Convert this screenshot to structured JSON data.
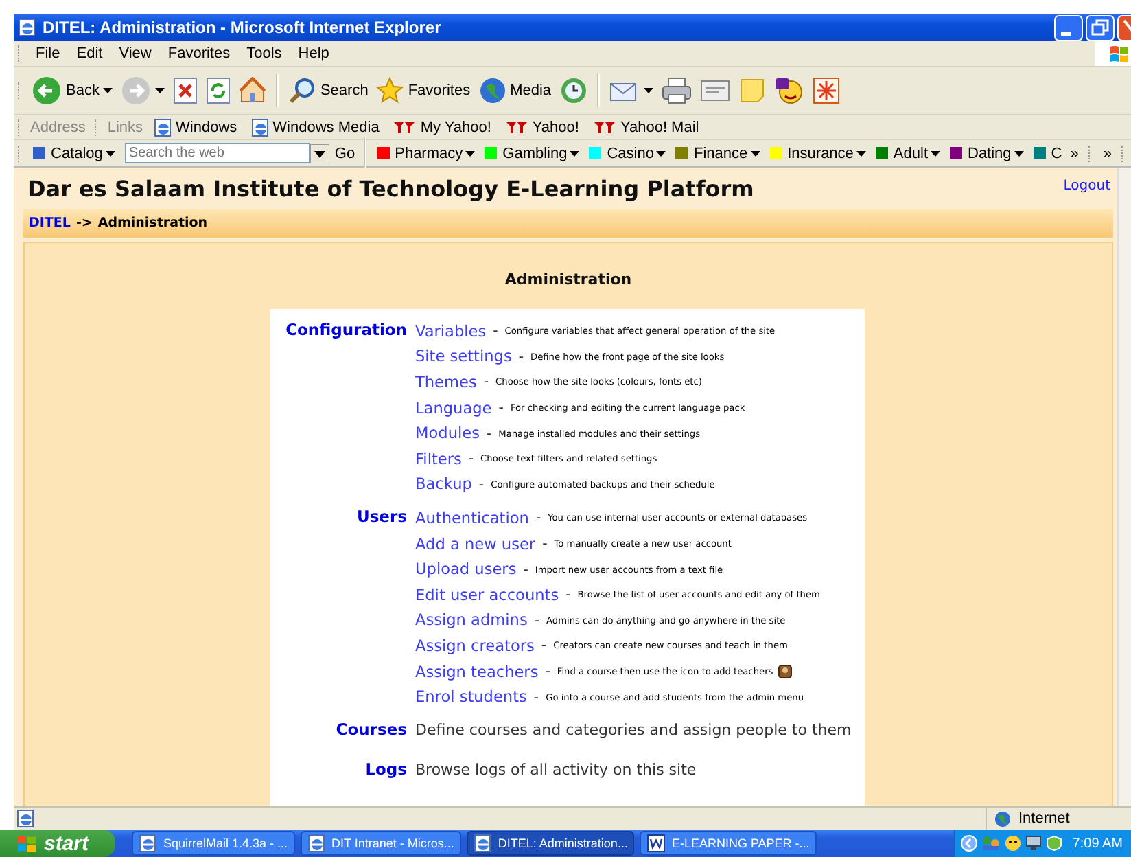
{
  "window": {
    "title": "DITEL: Administration - Microsoft Internet Explorer"
  },
  "menu": [
    "File",
    "Edit",
    "View",
    "Favorites",
    "Tools",
    "Help"
  ],
  "toolbar": {
    "back": "Back",
    "search": "Search",
    "favorites": "Favorites",
    "media": "Media"
  },
  "links_bar": {
    "address": "Address",
    "links": "Links",
    "items": [
      {
        "label": "Windows",
        "kind": "page"
      },
      {
        "label": "Windows Media",
        "kind": "page"
      },
      {
        "label": "My Yahoo!",
        "kind": "yahoo"
      },
      {
        "label": "Yahoo!",
        "kind": "yahoo"
      },
      {
        "label": "Yahoo! Mail",
        "kind": "yahoo"
      }
    ]
  },
  "yahoo_bar": {
    "catalog": "Catalog",
    "search": {
      "placeholder": "Search the web"
    },
    "go": "Go",
    "more": "»",
    "more_2": "»",
    "items": [
      {
        "label": "Pharmacy",
        "color": "#ff0000"
      },
      {
        "label": "Gambling",
        "color": "#00ff00"
      },
      {
        "label": "Casino",
        "color": "#00ffff"
      },
      {
        "label": "Finance",
        "color": "#808000"
      },
      {
        "label": "Insurance",
        "color": "#ffff00"
      },
      {
        "label": "Adult",
        "color": "#008000"
      },
      {
        "label": "Dating",
        "color": "#800080"
      },
      {
        "label": "C",
        "color": "#008080"
      }
    ]
  },
  "page": {
    "site_title": "Dar es Salaam Institute of Technology E-Learning Platform",
    "logout": "Logout",
    "breadcrumb": {
      "home": "DITEL",
      "separator": "->",
      "current": "Administration"
    },
    "heading": "Administration",
    "sections": [
      {
        "heading": "Configuration",
        "items": [
          {
            "link": "Variables",
            "separator": "-",
            "description": "Configure variables that affect general operation of the site"
          },
          {
            "link": "Site settings",
            "separator": "-",
            "description": "Define how the front page of the site looks"
          },
          {
            "link": "Themes",
            "separator": "-",
            "description": "Choose how the site looks (colours, fonts etc)"
          },
          {
            "link": "Language",
            "separator": "-",
            "description": "For checking and editing the current language pack"
          },
          {
            "link": "Modules",
            "separator": "-",
            "description": "Manage installed modules and their settings"
          },
          {
            "link": "Filters",
            "separator": "-",
            "description": "Choose text filters and related settings"
          },
          {
            "link": "Backup",
            "separator": "-",
            "description": "Configure automated backups and their schedule"
          }
        ]
      },
      {
        "heading": "Users",
        "items": [
          {
            "link": "Authentication",
            "separator": "-",
            "description": "You can use internal user accounts or external databases"
          },
          {
            "link": "Add a new user",
            "separator": "-",
            "description": "To manually create a new user account"
          },
          {
            "link": "Upload users",
            "separator": "-",
            "description": "Import new user accounts from a text file"
          },
          {
            "link": "Edit user accounts",
            "separator": "-",
            "description": "Browse the list of user accounts and edit any of them"
          },
          {
            "link": "Assign admins",
            "separator": "-",
            "description": "Admins can do anything and go anywhere in the site"
          },
          {
            "link": "Assign creators",
            "separator": "-",
            "description": "Creators can create new courses and teach in them"
          },
          {
            "link": "Assign teachers",
            "separator": "-",
            "description": "Find a course then use the icon to add teachers",
            "trailing_icon": true
          },
          {
            "link": "Enrol students",
            "separator": "-",
            "description": "Go into a course and add students from the admin menu"
          }
        ]
      },
      {
        "heading": "Courses",
        "description": "Define courses and categories and assign people to them"
      },
      {
        "heading": "Logs",
        "description": "Browse logs of all activity on this site"
      }
    ]
  },
  "status_bar": {
    "zone": "Internet"
  },
  "taskbar": {
    "start": "start",
    "clock": "7:09 AM",
    "tasks": [
      {
        "label": "SquirrelMail 1.4.3a - ...",
        "kind": "browser",
        "selected": false
      },
      {
        "label": "DIT Intranet - Micros...",
        "kind": "browser",
        "selected": false
      },
      {
        "label": "DITEL: Administration...",
        "kind": "browser",
        "selected": true
      },
      {
        "label": "E-LEARNING PAPER -...",
        "kind": "document",
        "selected": false
      }
    ]
  }
}
